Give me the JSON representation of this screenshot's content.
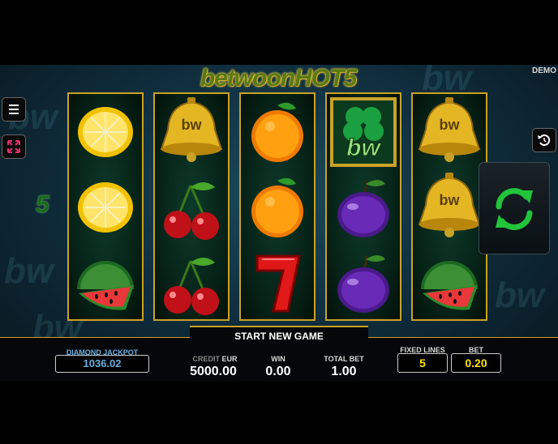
{
  "game": {
    "logo": "betwoonHOT5",
    "mode": "DEMO",
    "lines_indicator": "5",
    "start_title": "START NEW GAME"
  },
  "reels": [
    [
      "lemon",
      "lemon",
      "watermelon"
    ],
    [
      "bell-bw",
      "cherry",
      "cherry"
    ],
    [
      "orange",
      "orange",
      "seven"
    ],
    [
      "clover-bw",
      "plum",
      "plum"
    ],
    [
      "bell-bw",
      "bell-bw",
      "watermelon"
    ]
  ],
  "jackpot": {
    "label": "DIAMOND JACKPOT",
    "value": "1036.02"
  },
  "credit": {
    "label": "CREDIT",
    "currency": "EUR",
    "value": "5000.00"
  },
  "win": {
    "label": "WIN",
    "value": "0.00"
  },
  "total_bet": {
    "label": "TOTAL BET",
    "value": "1.00"
  },
  "fixed_lines": {
    "label": "FIXED LINES",
    "value": "5"
  },
  "bet": {
    "label": "BET",
    "value": "0.20"
  },
  "bw_text": "bw",
  "icons": [
    "menu-icon",
    "fullscreen-icon",
    "history-icon",
    "spin-icon"
  ],
  "colors": {
    "gold": "#c9a227",
    "accent_yellow": "#ffe100",
    "spin_green": "#22c43a",
    "fullscreen_pink": "#e0306a"
  }
}
